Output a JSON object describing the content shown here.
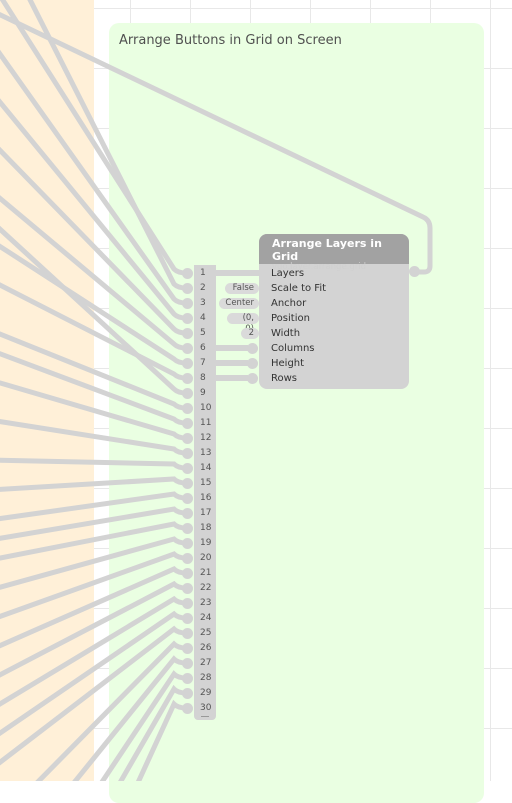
{
  "canvas": {
    "colors": {
      "background": "#ffffff",
      "grid_line": "#e8e8e8",
      "orange_comment": "#fff0d8",
      "green_comment": "#eaffe2",
      "cable": "#d3d3d3",
      "node_body": "#d3d3d3",
      "node_header": "#a2a2a2"
    }
  },
  "comment": {
    "title": "Arrange Buttons in Grid on Screen"
  },
  "list_node": {
    "items": [
      "1",
      "2",
      "3",
      "4",
      "5",
      "6",
      "7",
      "8",
      "9",
      "10",
      "11",
      "12",
      "13",
      "14",
      "15",
      "16",
      "17",
      "18",
      "19",
      "20",
      "21",
      "22",
      "23",
      "24",
      "25",
      "26",
      "27",
      "28",
      "29",
      "30"
    ]
  },
  "node": {
    "title": "Arrange Layers in Grid",
    "class_name": "vuo.layer.arrange.grid",
    "inputs": [
      {
        "label": "Layers",
        "constant": null,
        "connected": true
      },
      {
        "label": "Scale to Fit",
        "constant": "False",
        "connected": false
      },
      {
        "label": "Anchor",
        "constant": "Center",
        "connected": false
      },
      {
        "label": "Position",
        "constant": "(0, 0)",
        "connected": false
      },
      {
        "label": "Width",
        "constant": "2",
        "connected": false
      },
      {
        "label": "Columns",
        "constant": null,
        "connected": true
      },
      {
        "label": "Height",
        "constant": null,
        "connected": true
      },
      {
        "label": "Rows",
        "constant": null,
        "connected": true
      }
    ]
  }
}
